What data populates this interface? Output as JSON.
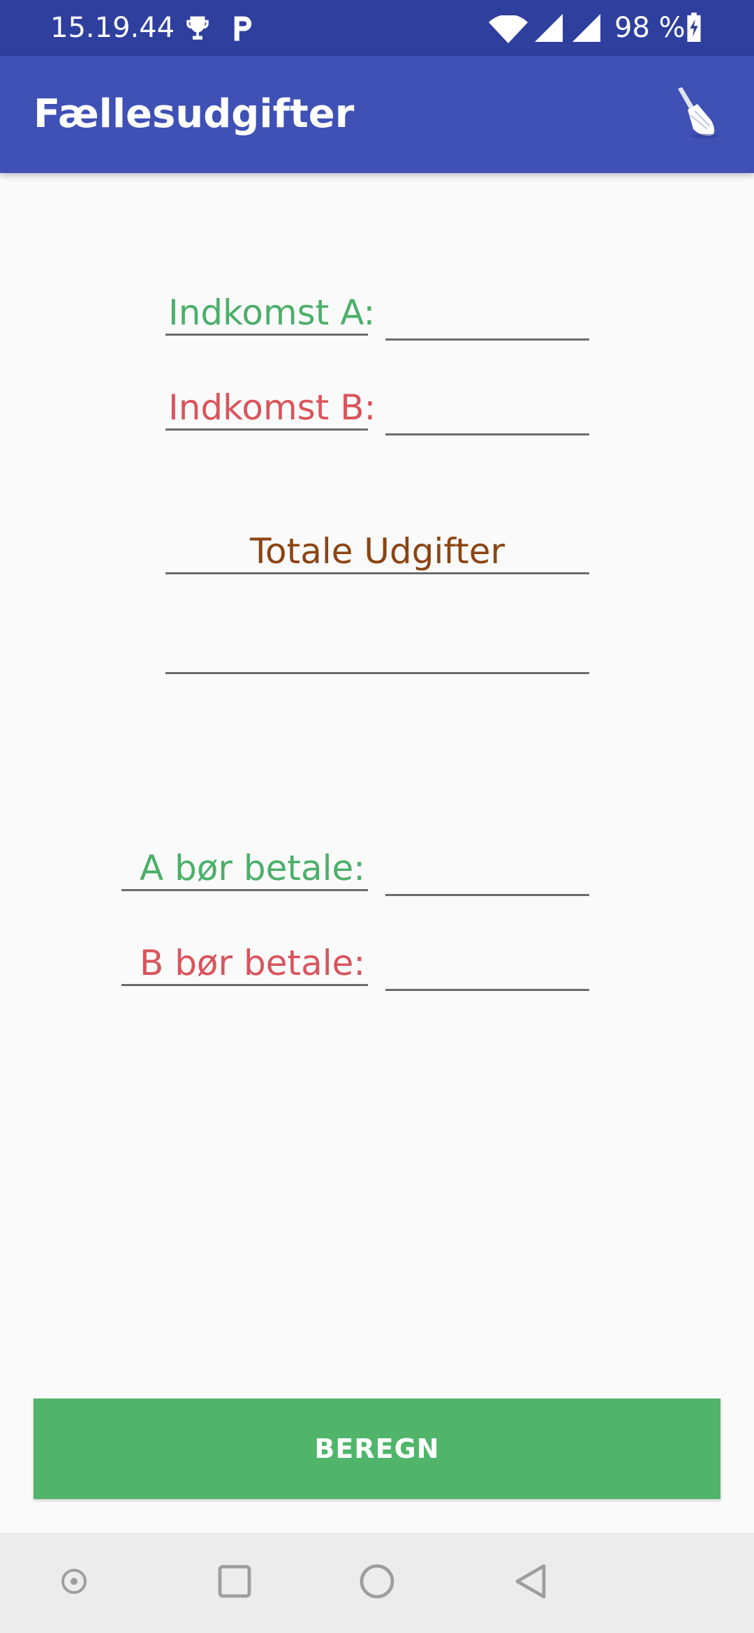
{
  "status_bar": {
    "time": "15.19.44",
    "battery": "98 %",
    "icons": [
      "trophy-icon",
      "parking-icon",
      "wifi-icon",
      "signal-icon",
      "signal-icon",
      "battery-icon"
    ]
  },
  "app_bar": {
    "title": "Fællesudgifter",
    "action_icon": "broom-icon",
    "background": "#3f51b5"
  },
  "form": {
    "income_a_label": "Indkomst A:",
    "income_a_value": "",
    "income_b_label": "Indkomst B:",
    "income_b_value": "",
    "total_expenses_label": "Totale Udgifter",
    "total_expenses_value": "",
    "a_should_pay_label": "A bør betale:",
    "a_should_pay_value": "",
    "b_should_pay_label": "B bør betale:",
    "b_should_pay_value": ""
  },
  "colors": {
    "person_a": "#4caf6a",
    "person_b": "#d9545c",
    "total": "#8b4513",
    "button": "#50b56a"
  },
  "button": {
    "label": "BEREGN"
  },
  "nav_bar": {
    "icons": [
      "dot-circle-icon",
      "recents-square-icon",
      "home-circle-icon",
      "back-triangle-icon"
    ]
  }
}
